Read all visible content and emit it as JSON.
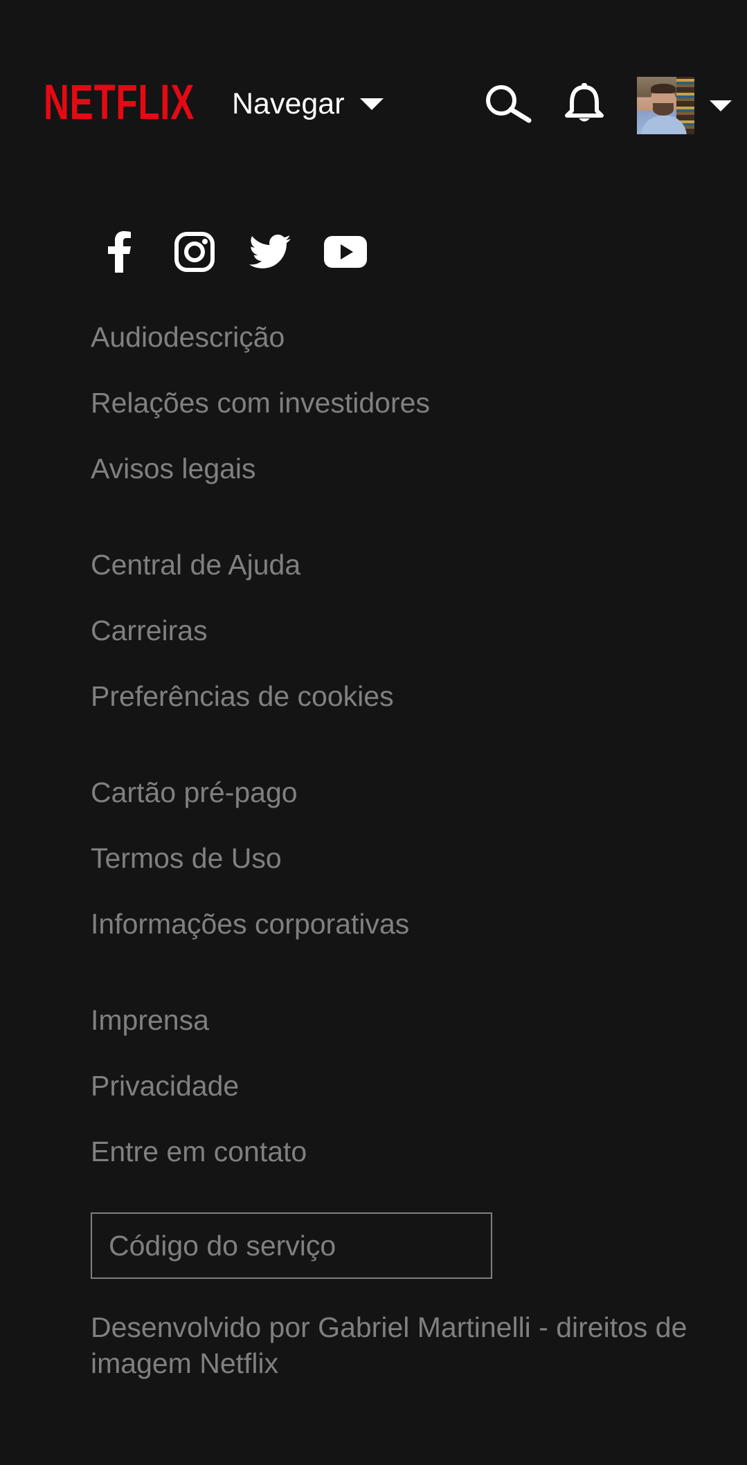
{
  "header": {
    "logo_text": "NETFLIX",
    "logo_color": "#e50914",
    "browse_label": "Navegar",
    "icons": [
      "search-icon",
      "bell-icon",
      "chevron-down-icon"
    ]
  },
  "social": [
    "facebook-icon",
    "instagram-icon",
    "twitter-icon",
    "youtube-icon"
  ],
  "footer": {
    "groups": [
      [
        "Audiodescrição",
        "Relações com investidores",
        "Avisos legais"
      ],
      [
        "Central de Ajuda",
        "Carreiras",
        "Preferências de cookies"
      ],
      [
        "Cartão pré-pago",
        "Termos de Uso",
        "Informações corporativas"
      ],
      [
        "Imprensa",
        "Privacidade",
        "Entre em contato"
      ]
    ],
    "service_code_label": "Código do serviço",
    "credits": "Desenvolvido por Gabriel Martinelli - direitos de imagem Netflix"
  },
  "colors": {
    "background": "#141414",
    "link_text": "#808080",
    "header_text": "#ffffff"
  }
}
